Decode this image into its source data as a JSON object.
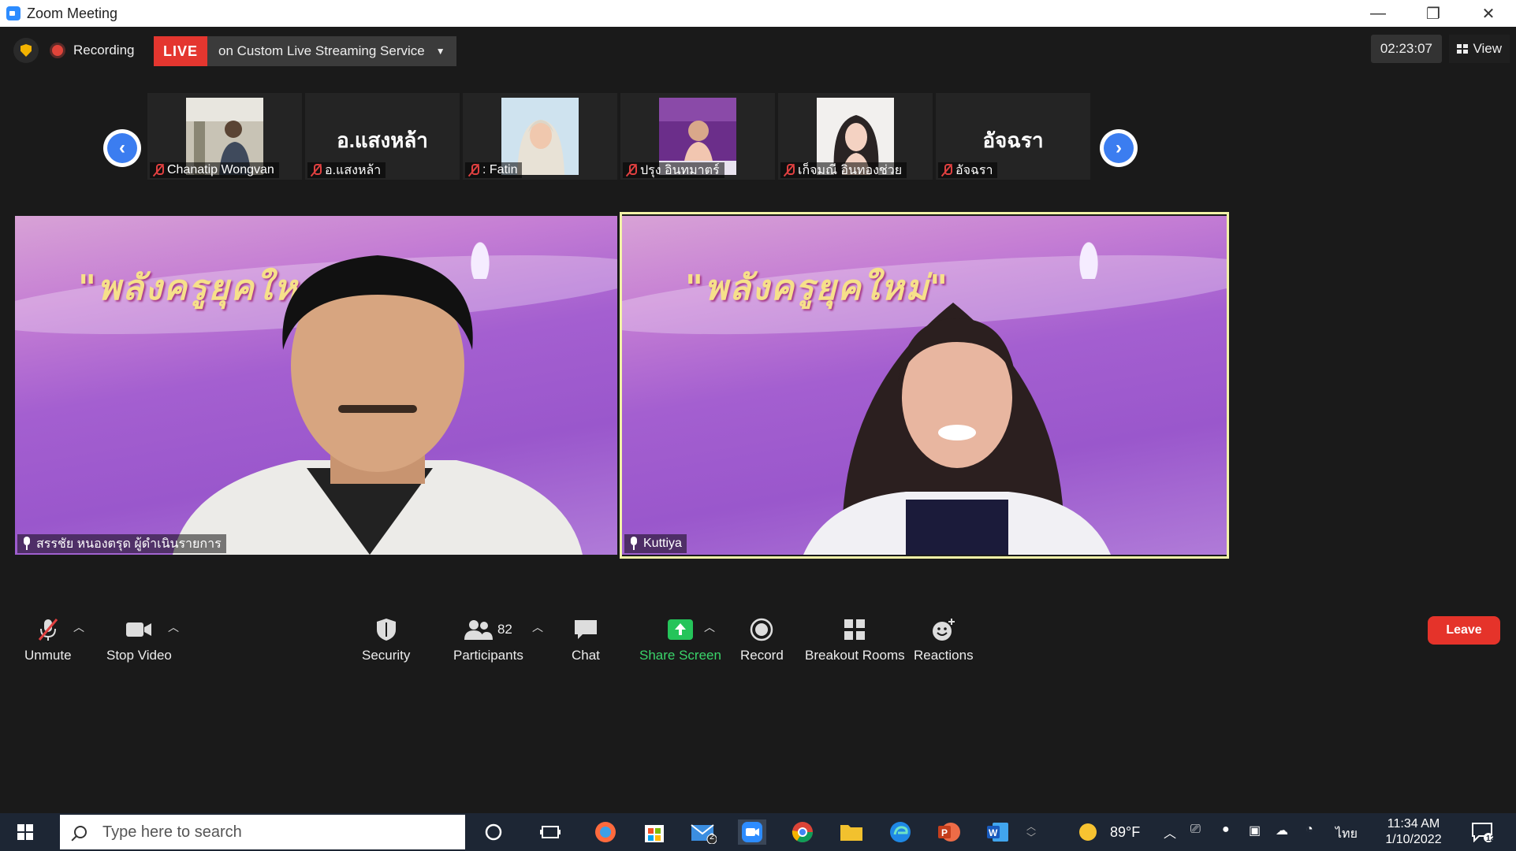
{
  "window": {
    "title": "Zoom Meeting",
    "minimize": "—",
    "restore": "❐",
    "close": "✕"
  },
  "topbar": {
    "recording_label": "Recording",
    "live_badge": "LIVE",
    "live_service": "on Custom Live Streaming Service",
    "timer": "02:23:07",
    "view_label": "View"
  },
  "filmstrip": {
    "participants": [
      {
        "name": "Chanatip Wongvan",
        "has_video": true
      },
      {
        "name": "อ.แสงหล้า",
        "has_video": false,
        "display": "อ.แสงหล้า"
      },
      {
        "name": ": Fatin",
        "has_video": true
      },
      {
        "name": "ปรุง อินทมาตร์",
        "has_video": true
      },
      {
        "name": "เก็จมณี อินทองช่วย",
        "has_video": true
      },
      {
        "name": "อัจฉรา",
        "has_video": false,
        "display": "อัจฉรา"
      }
    ]
  },
  "videos": [
    {
      "name": "สรรชัย หนองตรุด ผู้ดำเนินรายการ",
      "heading": "\"พลังครูยุคใหม่\"",
      "active": false
    },
    {
      "name": "Kuttiya",
      "heading": "\"พลังครูยุคใหม่\"",
      "active": true
    }
  ],
  "toolbar": {
    "unmute": "Unmute",
    "stop_video": "Stop Video",
    "security": "Security",
    "participants": "Participants",
    "participant_count": "82",
    "chat": "Chat",
    "share_screen": "Share Screen",
    "record": "Record",
    "breakout_rooms": "Breakout Rooms",
    "reactions": "Reactions",
    "leave": "Leave"
  },
  "taskbar": {
    "search_placeholder": "Type here to search",
    "mail_badge": "2",
    "weather": "89°F",
    "language": "ไทย",
    "time": "11:34 AM",
    "date": "1/10/2022",
    "notifications": "12"
  },
  "colors": {
    "live_red": "#e4362f",
    "accent_blue": "#3b7df0",
    "share_green": "#25c45a",
    "leave_red": "#e5332a",
    "active_speaker_border": "#f2f2a8"
  }
}
